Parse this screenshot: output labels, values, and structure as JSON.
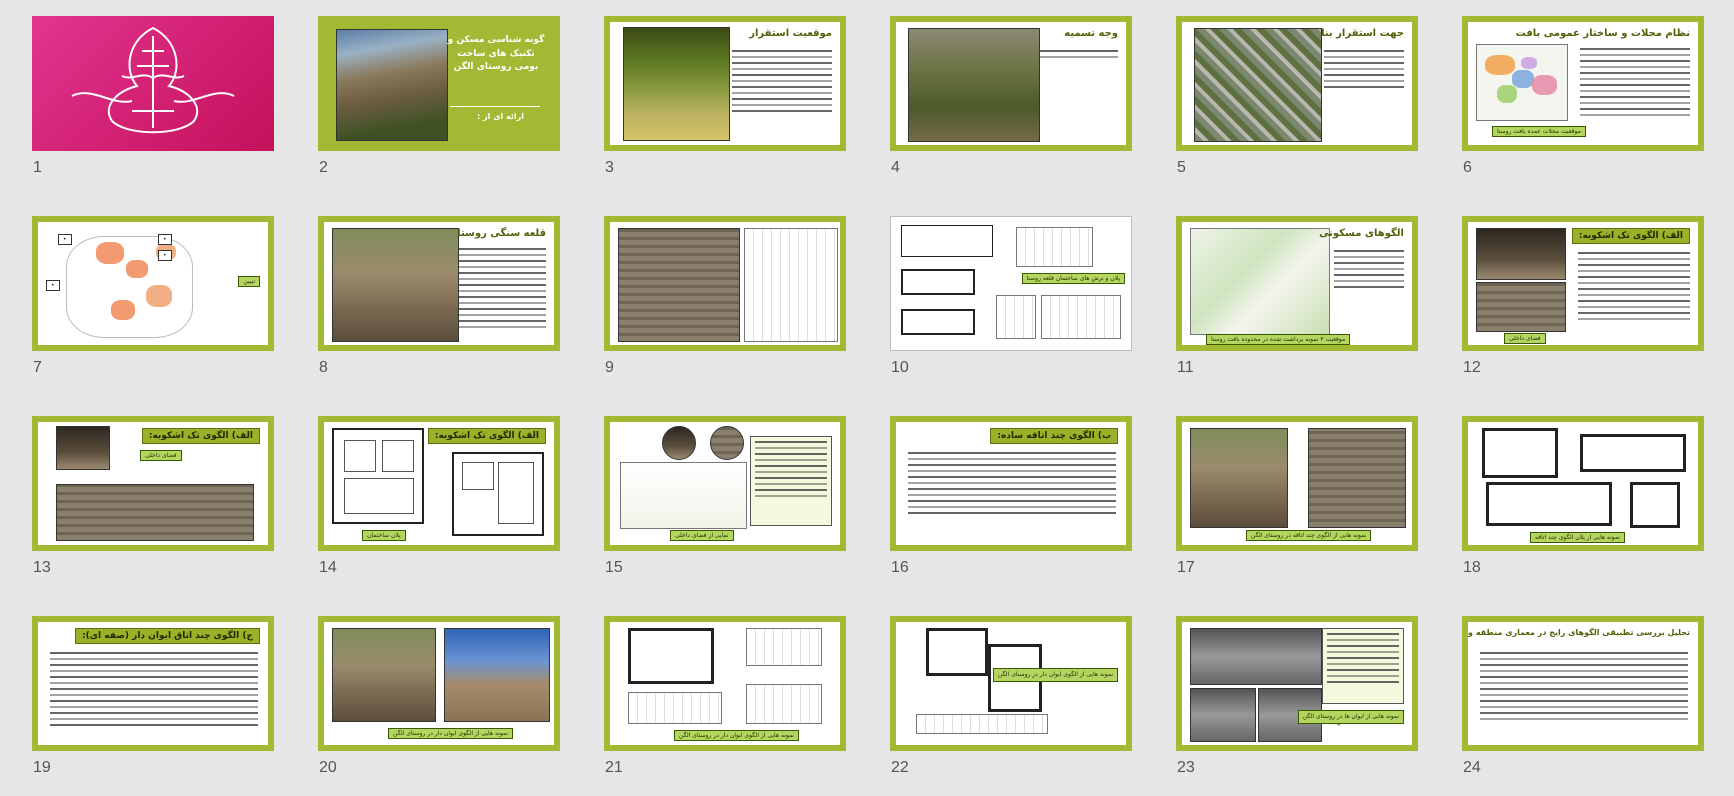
{
  "slides": [
    {
      "num": "1"
    },
    {
      "num": "2",
      "title": "گونه شناسی مسکن و تکنیک های ساخت بومی روستای الگن",
      "subtitle": "ارائه ای از :"
    },
    {
      "num": "3",
      "title": "موقعیت استقرار"
    },
    {
      "num": "4",
      "title": "وجه تسمیه"
    },
    {
      "num": "5",
      "title": "جهت استقرار بنا"
    },
    {
      "num": "6",
      "title": "نظام محلات و ساختار عمومی بافت",
      "caption": "موقعیت محلات عمده بافت روستا"
    },
    {
      "num": "7",
      "caption": "تبیین"
    },
    {
      "num": "8",
      "title": "قلعه سنگی روستا"
    },
    {
      "num": "9"
    },
    {
      "num": "10",
      "caption": "پلان و برش های ساختمان قلعه روستا"
    },
    {
      "num": "11",
      "title": "الگوهای مسکونی",
      "caption": "موقعیت ۳ نمونه برداشت شده در محدوده بافت روستا"
    },
    {
      "num": "12",
      "title": "الف) الگوی تک اشکوبه:",
      "caption": "فضای داخلی"
    },
    {
      "num": "13",
      "title": "الف) الگوی تک اشکوبه:",
      "caption": "فضای داخلی"
    },
    {
      "num": "14",
      "title": "الف) الگوی تک اشکوبه:",
      "caption": "پلان ساختمان"
    },
    {
      "num": "15",
      "caption": "نمایی از فضای داخلی"
    },
    {
      "num": "16",
      "title": "ب) الگوی چند اتاقه ساده:"
    },
    {
      "num": "17",
      "caption": "نمونه هایی از الگوی چند اتاقه در روستای الگن"
    },
    {
      "num": "18",
      "caption": "نمونه هایی از پلان الگوی چند اتاقه"
    },
    {
      "num": "19",
      "title": "ج) الگوی چند اتاق ایوان دار (صفه ای):"
    },
    {
      "num": "20",
      "caption": "نمونه هایی از الگوی ایوان دار در روستای الگن"
    },
    {
      "num": "21",
      "caption": "نمونه هایی از الگوی ایوان دار در روستای الگن"
    },
    {
      "num": "22",
      "caption": "نمونه هایی از الگوی ایوان دار در روستای الگن"
    },
    {
      "num": "23",
      "caption": "نمونه هایی از ایوان ها در روستای الگن"
    },
    {
      "num": "24",
      "title": "تحلیل بررسی تطبیقی الگوهای رایج در معماری منطقه و روستای الگن"
    }
  ],
  "colors": {
    "accent": "#a3b833",
    "title_green": "#4f6209",
    "caption_bg": "#b4d560",
    "pink": "#e3348f"
  }
}
